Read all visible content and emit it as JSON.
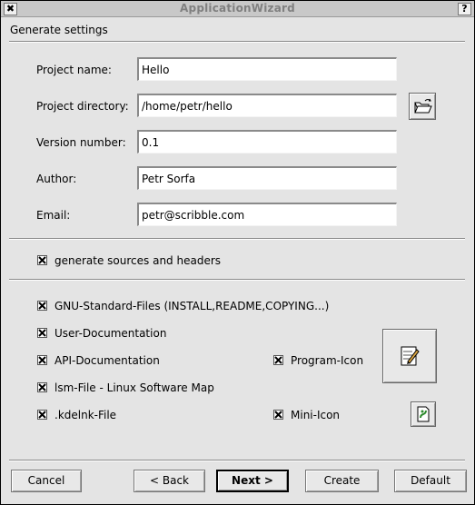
{
  "window": {
    "title": "ApplicationWizard",
    "close_glyph": "✖",
    "help_glyph": "?"
  },
  "section_title": "Generate settings",
  "form": {
    "project_name": {
      "label": "Project name:",
      "value": "Hello"
    },
    "project_directory": {
      "label": "Project directory:",
      "value": "/home/petr/hello"
    },
    "version_number": {
      "label": "Version number:",
      "value": "0.1"
    },
    "author": {
      "label": "Author:",
      "value": "Petr Sorfa"
    },
    "email": {
      "label": "Email:",
      "value": "petr@scribble.com"
    }
  },
  "options": {
    "generate_sources": {
      "label": "generate sources and headers",
      "checked": true
    },
    "gnu_standard_files": {
      "label": "GNU-Standard-Files (INSTALL,README,COPYING...)",
      "checked": true
    },
    "user_documentation": {
      "label": "User-Documentation",
      "checked": true
    },
    "api_documentation": {
      "label": "API-Documentation",
      "checked": true
    },
    "lsm_file": {
      "label": "lsm-File - Linux Software Map",
      "checked": true
    },
    "kdelnk_file": {
      "label": ".kdelnk-File",
      "checked": true
    },
    "program_icon": {
      "label": "Program-Icon",
      "checked": true
    },
    "mini_icon": {
      "label": "Mini-Icon",
      "checked": true
    }
  },
  "icons": {
    "browse": "folder-open-icon",
    "program_icon": "edit-document-icon",
    "mini_icon": "mini-icon-document"
  },
  "buttons": {
    "cancel": "Cancel",
    "back": "< Back",
    "next": "Next >",
    "create": "Create",
    "default": "Default"
  }
}
